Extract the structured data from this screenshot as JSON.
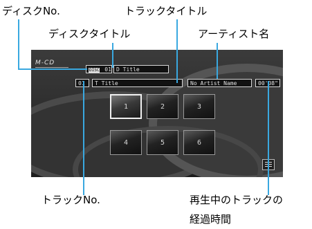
{
  "callouts": {
    "disc_no": "ディスクNo.",
    "track_title": "トラックタイトル",
    "disc_title": "ディスクタイトル",
    "artist_name": "アーティスト名",
    "track_no": "トラックNo.",
    "elapsed_line1": "再生中のトラックの",
    "elapsed_line2": "経過時間"
  },
  "screen": {
    "logo": "M-CD",
    "source_tag": "DISC",
    "disc_no": "01",
    "disc_title": "D Title",
    "track_no": "01",
    "track_title": "T Title",
    "artist": "No Artist Name",
    "elapsed": "00'08\"",
    "track_buttons": [
      "1",
      "2",
      "3",
      "4",
      "5",
      "6"
    ],
    "selected_button": "1",
    "list_icon": "list-icon"
  }
}
